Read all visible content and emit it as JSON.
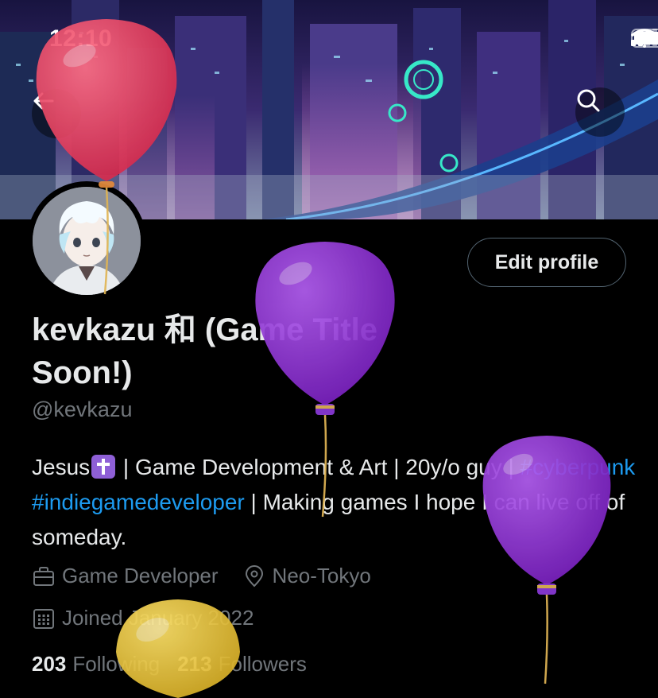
{
  "status_bar": {
    "time": "12:10",
    "icons": [
      "signal-icon",
      "wifi-icon",
      "battery-icon"
    ]
  },
  "header": {
    "back_icon": "arrow-left-icon",
    "search_icon": "search-icon"
  },
  "profile": {
    "display_name": "kevkazu 和 (Game Title Soon!)",
    "handle": "@kevkazu",
    "edit_button_label": "Edit profile",
    "bio": {
      "part1": "Jesus",
      "part2": " | Game Development & Art | 20y/o guy | ",
      "hashtag1": "#cyberpunk",
      "hashtag2": "#indiegamedeveloper",
      "part3": " | Making games I hope I can live off of someday."
    },
    "occupation": "Game Developer",
    "location": "Neo-Tokyo",
    "joined": "Joined January 2022",
    "following_count": "203",
    "following_label": "Following",
    "followers_count": "213",
    "followers_label": "Followers"
  },
  "colors": {
    "background": "#000000",
    "link": "#1d9bf0",
    "secondary_text": "#71767b",
    "balloon_red": "#e23a5a",
    "balloon_purple": "#8a2ed0",
    "balloon_yellow": "#e8c13a"
  }
}
